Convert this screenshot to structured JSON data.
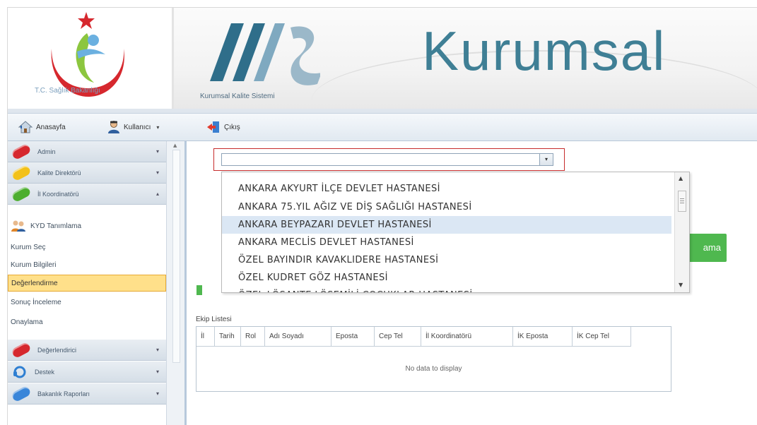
{
  "header": {
    "ministry_name": "T.C. Sağlık Bakanlığı",
    "system_name": "Kurumsal Kalite Sistemi",
    "brand_title": "Kurumsal"
  },
  "toolbar": {
    "home_label": "Anasayfa",
    "user_label": "Kullanıcı",
    "logout_label": "Çıkış"
  },
  "sidebar": {
    "groups": [
      {
        "label": "Admin",
        "color": "#d6282e",
        "caret": "⌄"
      },
      {
        "label": "Kalite Direktörü",
        "color": "#f2c11a",
        "caret": "⌄"
      },
      {
        "label": "İl Koordinatörü",
        "color": "#4cae2f",
        "caret": "⌃"
      },
      {
        "label": "Değerlendirici",
        "color": "#d6282e",
        "caret": "⌄"
      },
      {
        "label": "Destek",
        "color": "#2f7fd2",
        "caret": "⌄"
      },
      {
        "label": "Bakanlık Raporları",
        "color": "#3a86d9",
        "caret": "⌄"
      }
    ],
    "items": [
      {
        "label": "KYD Tanımlama",
        "active": false
      },
      {
        "label": "Kurum Seç",
        "active": false
      },
      {
        "label": "Kurum Bilgileri",
        "active": false
      },
      {
        "label": "Değerlendirme",
        "active": true
      },
      {
        "label": "Sonuç İnceleme",
        "active": false
      },
      {
        "label": "Onaylama",
        "active": false
      }
    ]
  },
  "combo": {
    "value": "",
    "options": [
      "ANKARA AKYURT İLÇE DEVLET HASTANESİ",
      "ANKARA 75.YIL AĞIZ VE DİŞ SAĞLIĞI HASTANESİ",
      "ANKARA BEYPAZARI DEVLET HASTANESİ",
      "ANKARA MECLİS DEVLET HASTANESİ",
      "ÖZEL BAYINDIR KAVAKLIDERE HASTANESİ",
      "ÖZEL KUDRET GÖZ HASTANESİ",
      "ÖZEL LÖSANTE LÖSEMİLİ ÇOCUKLAR HASTANESİ"
    ],
    "selected_option": "ANKARA BEYPAZARI DEVLET HASTANESİ"
  },
  "green_button_label": "ama",
  "ekip": {
    "title": "Ekip Listesi",
    "columns": [
      "İl",
      "Tarih",
      "Rol",
      "Adı Soyadı",
      "Eposta",
      "Cep Tel",
      "İl Koordinatörü",
      "İK Eposta",
      "İK Cep Tel"
    ],
    "empty_text": "No data to display"
  },
  "colors": {
    "accent": "#3f7f95",
    "selection": "#dbe7f4",
    "active_menu": "#ffe08a",
    "button_green": "#4fb84f",
    "combo_border": "#c62c2c"
  }
}
